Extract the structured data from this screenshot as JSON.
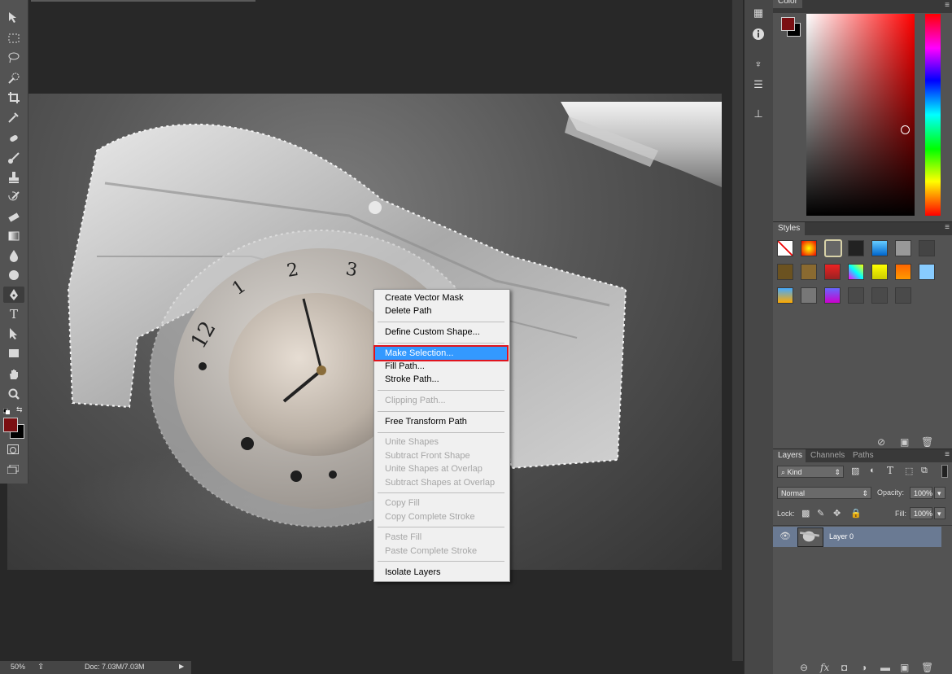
{
  "toolbar": {
    "tools": [
      "move-tool",
      "marquee-tool",
      "lasso-tool",
      "quick-selection-tool",
      "crop-tool",
      "eyedropper-tool",
      "healing-brush-tool",
      "brush-tool",
      "clone-stamp-tool",
      "history-brush-tool",
      "eraser-tool",
      "gradient-tool",
      "blur-tool",
      "dodge-tool",
      "pen-tool",
      "type-tool",
      "path-selection-tool",
      "rectangle-tool",
      "hand-tool",
      "zoom-tool"
    ],
    "active_tool": "pen-tool",
    "foreground_color": "#7a0f12",
    "background_color": "#000000"
  },
  "canvas": {
    "watch_numbers": [
      "12",
      "1",
      "2",
      "3"
    ]
  },
  "context_menu": {
    "items": [
      {
        "label": "Create Vector Mask",
        "enabled": true
      },
      {
        "label": "Delete Path",
        "enabled": true
      },
      {
        "label": "Define Custom Shape...",
        "enabled": true
      },
      {
        "label": "Make Selection...",
        "enabled": true,
        "highlighted": true
      },
      {
        "label": "Fill Path...",
        "enabled": true
      },
      {
        "label": "Stroke Path...",
        "enabled": true
      },
      {
        "label": "Clipping Path...",
        "enabled": false
      },
      {
        "label": "Free Transform Path",
        "enabled": true
      },
      {
        "label": "Unite Shapes",
        "enabled": false
      },
      {
        "label": "Subtract Front Shape",
        "enabled": false
      },
      {
        "label": "Unite Shapes at Overlap",
        "enabled": false
      },
      {
        "label": "Subtract Shapes at Overlap",
        "enabled": false
      },
      {
        "label": "Copy Fill",
        "enabled": false
      },
      {
        "label": "Copy Complete Stroke",
        "enabled": false
      },
      {
        "label": "Paste Fill",
        "enabled": false
      },
      {
        "label": "Paste Complete Stroke",
        "enabled": false
      },
      {
        "label": "Isolate Layers",
        "enabled": true
      }
    ],
    "highlight_color": "#3399ff",
    "highlight_outline": "#e0141e"
  },
  "status_bar": {
    "zoom": "50%",
    "doc_info": "Doc: 7.03M/7.03M"
  },
  "color_panel": {
    "tab": "Color",
    "foreground_color": "#7a0f12"
  },
  "styles_panel": {
    "tab": "Styles"
  },
  "layers_panel": {
    "tabs": [
      "Layers",
      "Channels",
      "Paths"
    ],
    "active_tab": "Layers",
    "filter_kind": "Kind",
    "blend_mode": "Normal",
    "opacity_label": "Opacity:",
    "opacity_value": "100%",
    "lock_label": "Lock:",
    "fill_label": "Fill:",
    "fill_value": "100%",
    "layers": [
      {
        "name": "Layer 0",
        "visible": true,
        "selected": true
      }
    ]
  }
}
